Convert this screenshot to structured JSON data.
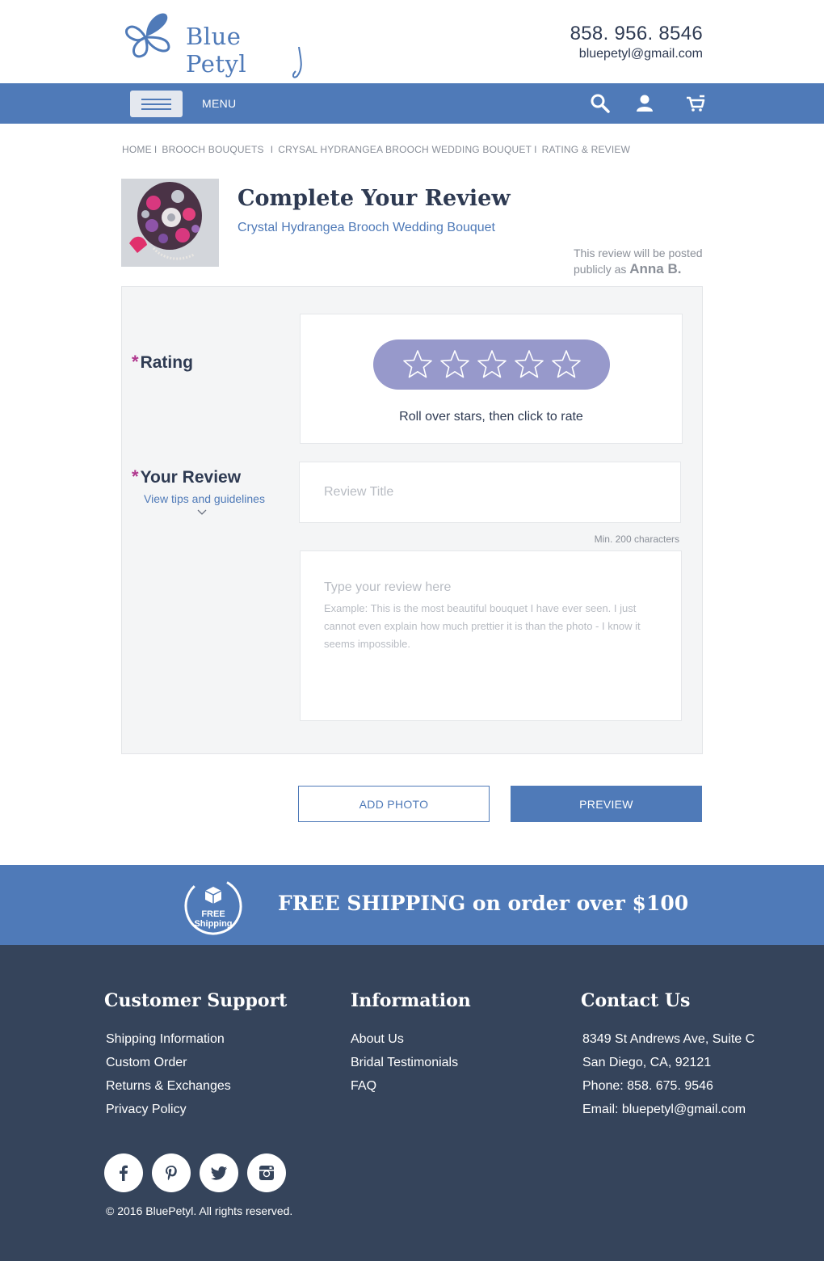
{
  "header": {
    "brand": "Blue Petyl",
    "phone": "858. 956. 8546",
    "email": "bluepetyl@gmail.com"
  },
  "nav": {
    "menu_label": "MENU",
    "icons": [
      "search-icon",
      "user-icon",
      "cart-icon"
    ]
  },
  "breadcrumb": [
    "HOME",
    "BROOCH BOUQUETS",
    "CRYSAL HYDRANGEA BROOCH WEDDING BOUQUET",
    "RATING & REVIEW"
  ],
  "breadcrumb_separator": "I",
  "review": {
    "title": "Complete Your Review",
    "product_name": "Crystal Hydrangea Brooch Wedding Bouquet",
    "posted_prefix": "This review will be posted publicly as",
    "posted_name": "Anna B.",
    "required_mark": "*",
    "rating_label": "Rating",
    "rating_value": 0,
    "rating_max": 5,
    "rating_hint": "Roll over stars, then click to rate",
    "review_label": "Your Review",
    "tips_link": "View tips and guidelines",
    "title_placeholder": "Review Title",
    "min_chars": "Min. 200 characters",
    "body_placeholder": "Type your review here",
    "body_example": "Example: This is the most beautiful bouquet I have ever seen. I just cannot even explain how much prettier it is than the photo - I know it seems impossible."
  },
  "buttons": {
    "add_photo": "ADD PHOTO",
    "preview": "PREVIEW"
  },
  "shipping": {
    "badge_line1": "FREE",
    "badge_line2": "Shipping",
    "text": "FREE SHIPPING on order over $100"
  },
  "footer": {
    "support": {
      "heading": "Customer Support",
      "links": [
        "Shipping Information",
        "Custom Order",
        "Returns & Exchanges",
        "Privacy Policy"
      ]
    },
    "info": {
      "heading": "Information",
      "links": [
        "About Us",
        "Bridal Testimonials",
        "FAQ"
      ]
    },
    "contact": {
      "heading": "Contact Us",
      "lines": [
        "8349 St Andrews Ave, Suite C",
        "San Diego, CA, 92121",
        "Phone: 858. 675. 9546",
        "Email: bluepetyl@gmail.com"
      ]
    },
    "socials": [
      "facebook-icon",
      "pinterest-icon",
      "twitter-icon",
      "instagram-icon"
    ],
    "copyright": "©  2016 BluePetyl. All rights reserved."
  },
  "colors": {
    "brand_blue": "#4f7ab8",
    "navy": "#35445b",
    "star_pill": "#9799cb",
    "required": "#b0378e"
  }
}
